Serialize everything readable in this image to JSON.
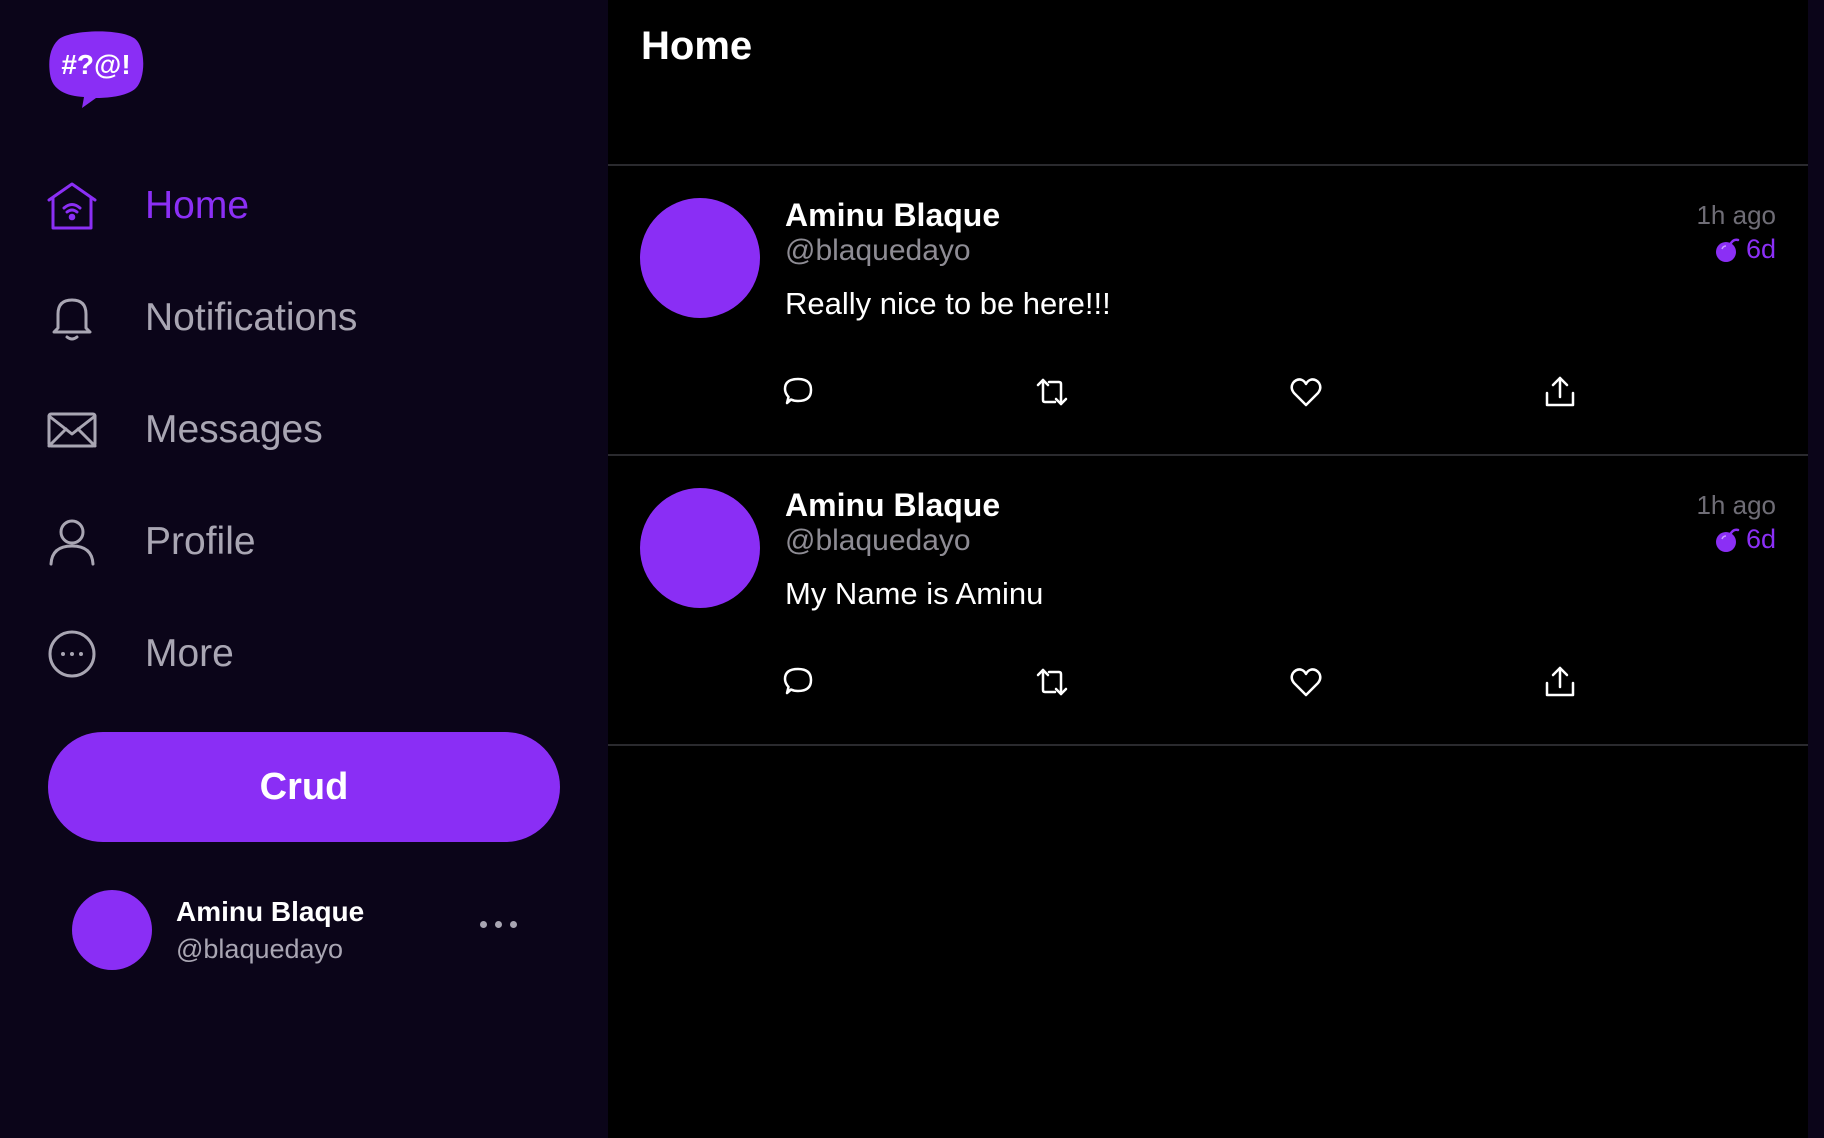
{
  "app": {
    "logo_text": "#?@!",
    "accent": "#8a2ef5",
    "sidebar_bg": "#0b0519"
  },
  "nav": {
    "items": [
      {
        "label": "Home",
        "icon": "home-icon",
        "active": true
      },
      {
        "label": "Notifications",
        "icon": "bell-icon",
        "active": false
      },
      {
        "label": "Messages",
        "icon": "envelope-icon",
        "active": false
      },
      {
        "label": "Profile",
        "icon": "person-icon",
        "active": false
      },
      {
        "label": "More",
        "icon": "more-circle-icon",
        "active": false
      }
    ]
  },
  "compose": {
    "label": "Crud"
  },
  "account": {
    "name": "Aminu Blaque",
    "handle": "@blaquedayo"
  },
  "main": {
    "title": "Home"
  },
  "posts": [
    {
      "name": "Aminu Blaque",
      "handle": "@blaquedayo",
      "text": "Really nice to be here!!!",
      "time": "1h ago",
      "expires": "6d"
    },
    {
      "name": "Aminu Blaque",
      "handle": "@blaquedayo",
      "text": "My Name is Aminu",
      "time": "1h ago",
      "expires": "6d"
    }
  ],
  "post_actions": [
    "reply-icon",
    "repost-icon",
    "like-icon",
    "share-icon"
  ]
}
